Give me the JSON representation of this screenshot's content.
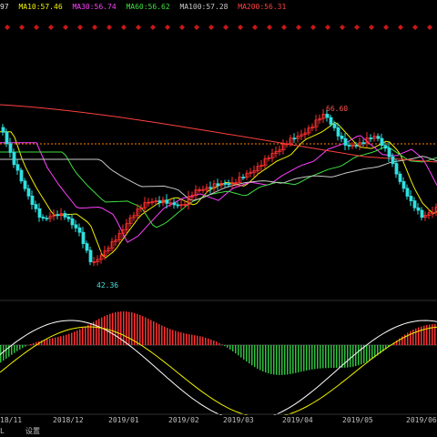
{
  "legend": [
    {
      "label": "97",
      "color": "#e0e0e0"
    },
    {
      "label": "MA10:57.46",
      "color": "#f0f000"
    },
    {
      "label": "MA30:56.74",
      "color": "#ff40ff"
    },
    {
      "label": "MA60:56.62",
      "color": "#40e040"
    },
    {
      "label": "MA100:57.28",
      "color": "#c8c8c8"
    },
    {
      "label": "MA200:56.31",
      "color": "#ff4040"
    }
  ],
  "annotations": {
    "high": "66.60",
    "low": "42.36"
  },
  "date_axis": [
    "18/11",
    "2018/12",
    "2019/01",
    "2019/02",
    "2019/03",
    "2019/04",
    "2019/05",
    "2019/06"
  ],
  "bottom_bar": {
    "left_label": "L",
    "settings_label": "设置"
  },
  "colors": {
    "up": "#ff3030",
    "down": "#30e0e0",
    "high_label": "#ff5050",
    "low_label": "#50e0e0",
    "marker": "#ff2020",
    "ref_line": "#ff8000"
  }
}
